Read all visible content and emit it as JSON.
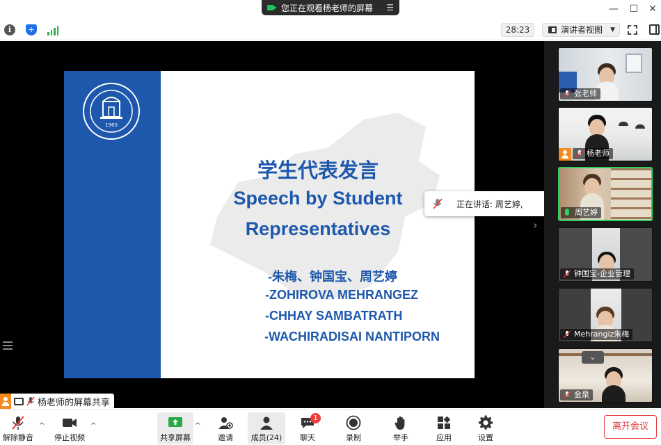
{
  "title_bar": {
    "viewing_text": "您正在观看杨老师的屏幕",
    "minimize": "—",
    "maximize": "☐",
    "close": "✕"
  },
  "status_row": {
    "timer": "28:23",
    "view_mode": "演讲者视图",
    "info_glyph": "i",
    "shield_glyph": "+"
  },
  "slide": {
    "title_cn": "学生代表发言",
    "title_en_line1": "Speech by Student",
    "title_en_line2": "Representatives",
    "names": [
      "-朱梅、钟国宝、周艺婷",
      "-ZOHIROVA  MEHRANGEZ",
      "-CHHAY SAMBATRATH",
      "-WACHIRADISAI NANTIPORN"
    ],
    "logo_year": "1960",
    "accent_color": "#1e58ac"
  },
  "speaking_popup": {
    "label": "正在讲话: 周艺婷,"
  },
  "gallery": {
    "participants": [
      {
        "name": "张老师",
        "muted": true,
        "host": false
      },
      {
        "name": "杨老师",
        "muted": true,
        "host": true
      },
      {
        "name": "周艺婷",
        "muted": false,
        "host": false
      },
      {
        "name": "钟国宝-企业管理",
        "muted": true,
        "host": false
      },
      {
        "name": "Mehrangiz朱梅",
        "muted": true,
        "host": false
      },
      {
        "name": "金泉",
        "muted": true,
        "host": false
      }
    ],
    "scroll_glyph": "⌄"
  },
  "share_label": {
    "text": "杨老师的屏幕共享"
  },
  "toolbar": {
    "unmute": "解除静音",
    "stop_video": "停止视频",
    "share_screen": "共享屏幕",
    "invite": "邀请",
    "participants": "成员(24)",
    "chat": "聊天",
    "chat_badge": "1",
    "record": "录制",
    "raise_hand": "举手",
    "apps": "应用",
    "settings": "设置",
    "leave": "离开会议"
  }
}
